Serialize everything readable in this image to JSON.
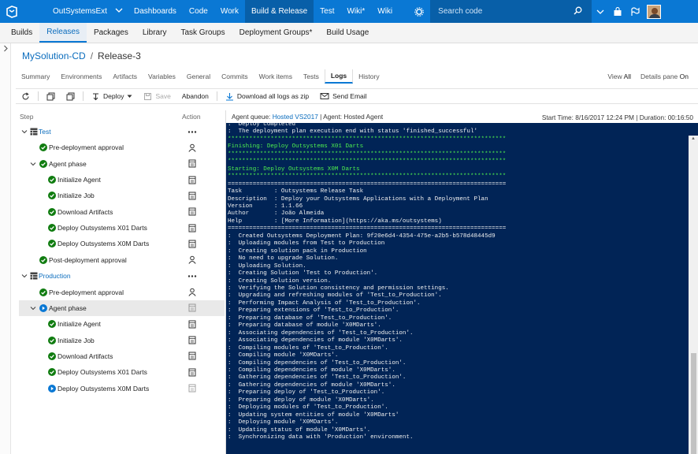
{
  "topbar": {
    "account": "OutSystemsExt",
    "nav": [
      "Dashboards",
      "Code",
      "Work",
      "Build & Release",
      "Test",
      "Wiki*",
      "Wiki"
    ],
    "active_nav": "Build & Release",
    "search_placeholder": "Search code"
  },
  "subnav": {
    "tabs": [
      "Builds",
      "Releases",
      "Packages",
      "Library",
      "Task Groups",
      "Deployment Groups*",
      "Build Usage"
    ],
    "active": "Releases"
  },
  "breadcrumb": {
    "definition": "MySolution-CD",
    "separator": "/",
    "release": "Release-3"
  },
  "release_tabs": {
    "tabs": [
      "Summary",
      "Environments",
      "Artifacts",
      "Variables",
      "General",
      "Commits",
      "Work items",
      "Tests",
      "Logs",
      "History"
    ],
    "active": "Logs"
  },
  "view_options": {
    "view_label": "View",
    "view_value": "All",
    "details_label": "Details pane",
    "details_value": "On"
  },
  "toolbar": {
    "deploy": "Deploy",
    "save": "Save",
    "abandon": "Abandon",
    "download": "Download all logs as zip",
    "email": "Send Email"
  },
  "steps_panel": {
    "col_step": "Step",
    "col_action": "Action",
    "rows": [
      {
        "label": "Test",
        "kind": "stage",
        "status": "none",
        "action": "more"
      },
      {
        "label": "Pre-deployment approval",
        "kind": "approval",
        "status": "success",
        "action": "person"
      },
      {
        "label": "Agent phase",
        "kind": "phase",
        "status": "success",
        "action": "log"
      },
      {
        "label": "Initialize Agent",
        "kind": "task",
        "status": "success",
        "action": "log"
      },
      {
        "label": "Initialize Job",
        "kind": "task",
        "status": "success",
        "action": "log"
      },
      {
        "label": "Download Artifacts",
        "kind": "task",
        "status": "success",
        "action": "log"
      },
      {
        "label": "Deploy Outsystems X01 Darts",
        "kind": "task",
        "status": "success",
        "action": "log"
      },
      {
        "label": "Deploy Outsystems X0M Darts",
        "kind": "task",
        "status": "success",
        "action": "log"
      },
      {
        "label": "Post-deployment approval",
        "kind": "approval",
        "status": "success",
        "action": "person"
      },
      {
        "label": "Production",
        "kind": "stage",
        "status": "none",
        "action": "more"
      },
      {
        "label": "Pre-deployment approval",
        "kind": "approval",
        "status": "success",
        "action": "person"
      },
      {
        "label": "Agent phase",
        "kind": "phase",
        "status": "running",
        "action": "log"
      },
      {
        "label": "Initialize Agent",
        "kind": "task",
        "status": "success",
        "action": "log"
      },
      {
        "label": "Initialize Job",
        "kind": "task",
        "status": "success",
        "action": "log"
      },
      {
        "label": "Download Artifacts",
        "kind": "task",
        "status": "success",
        "action": "log"
      },
      {
        "label": "Deploy Outsystems X01 Darts",
        "kind": "task",
        "status": "success",
        "action": "log"
      },
      {
        "label": "Deploy Outsystems X0M Darts",
        "kind": "task",
        "status": "running",
        "action": "log"
      }
    ]
  },
  "log_header": {
    "queue_label": "Agent queue:",
    "queue": "Hosted VS2017",
    "agent": "| Agent: Hosted Agent",
    "start": "Start Time: 8/16/2017 12:24 PM | Duration: 00:16:50"
  },
  "console_lines": [
    {
      "t": ":  Deploy completed",
      "c": "w"
    },
    {
      "t": ":  The deployment plan execution end with status 'finished_successful'",
      "c": "w"
    },
    {
      "t": "******************************************************************************",
      "c": "g"
    },
    {
      "t": "Finishing: Deploy Outsystems X01 Darts",
      "c": "g"
    },
    {
      "t": "******************************************************************************",
      "c": "g"
    },
    {
      "t": "******************************************************************************",
      "c": "g"
    },
    {
      "t": "Starting: Deploy Outsystems X0M Darts",
      "c": "g"
    },
    {
      "t": "******************************************************************************",
      "c": "g"
    },
    {
      "t": "==============================================================================",
      "c": "w"
    },
    {
      "t": "Task         : Outsystems Release Task",
      "c": "w"
    },
    {
      "t": "Description  : Deploy your Outsystems Applications with a Deployment Plan",
      "c": "w"
    },
    {
      "t": "Version      : 1.1.66",
      "c": "w"
    },
    {
      "t": "Author       : João Almeida",
      "c": "w"
    },
    {
      "t": "Help         : [More Information](https://aka.ms/outsystems)",
      "c": "w"
    },
    {
      "t": "==============================================================================",
      "c": "w"
    },
    {
      "t": ":  Created Outsystems Deployment Plan: 9f20e6d4-4354-475e-a2b5-b578d48445d9",
      "c": "w"
    },
    {
      "t": ":  Uploading modules from Test to Production",
      "c": "w"
    },
    {
      "t": ":  Creating solution pack in Production",
      "c": "w"
    },
    {
      "t": ":  No need to upgrade Solution.",
      "c": "w"
    },
    {
      "t": ":  Uploading Solution.",
      "c": "w"
    },
    {
      "t": ":  Creating Solution 'Test to Production'.",
      "c": "w"
    },
    {
      "t": ":  Creating Solution version.",
      "c": "w"
    },
    {
      "t": ":  Verifying the Solution consistency and permission settings.",
      "c": "w"
    },
    {
      "t": ":  Upgrading and refreshing modules of 'Test_to_Production'.",
      "c": "w"
    },
    {
      "t": ":  Performing Impact Analysis of 'Test_to_Production'.",
      "c": "w"
    },
    {
      "t": ":  Preparing extensions of 'Test_to_Production'.",
      "c": "w"
    },
    {
      "t": ":  Preparing database of 'Test_to_Production'.",
      "c": "w"
    },
    {
      "t": ":  Preparing database of module 'X0MDarts'.",
      "c": "w"
    },
    {
      "t": ":  Associating dependencies of 'Test_to_Production'.",
      "c": "w"
    },
    {
      "t": ":  Associating dependencies of module 'X0MDarts'.",
      "c": "w"
    },
    {
      "t": ":  Compiling modules of 'Test_to_Production'.",
      "c": "w"
    },
    {
      "t": ":  Compiling module 'X0MDarts'.",
      "c": "w"
    },
    {
      "t": ":  Compiling dependencies of 'Test_to_Production'.",
      "c": "w"
    },
    {
      "t": ":  Compiling dependencies of module 'X0MDarts'.",
      "c": "w"
    },
    {
      "t": ":  Gathering dependencies of 'Test_to_Production'.",
      "c": "w"
    },
    {
      "t": ":  Gathering dependencies of module 'X0MDarts'.",
      "c": "w"
    },
    {
      "t": ":  Preparing deploy of 'Test_to_Production'.",
      "c": "w"
    },
    {
      "t": ":  Preparing deploy of module 'X0MDarts'.",
      "c": "w"
    },
    {
      "t": ":  Deploying modules of 'Test_to_Production'.",
      "c": "w"
    },
    {
      "t": ":  Updating system entities of module 'X0MDarts'",
      "c": "w"
    },
    {
      "t": ":  Deploying module 'X0MDarts'.",
      "c": "w"
    },
    {
      "t": ":  Updating status of module 'X0MDarts'.",
      "c": "w"
    },
    {
      "t": ":  Synchronizing data with 'Production' environment.",
      "c": "w"
    }
  ],
  "colors": {
    "brand": "#0a78d4",
    "console_bg": "#012456",
    "console_green": "#4eef4e",
    "success": "#107c10",
    "running": "#0a78d4"
  }
}
